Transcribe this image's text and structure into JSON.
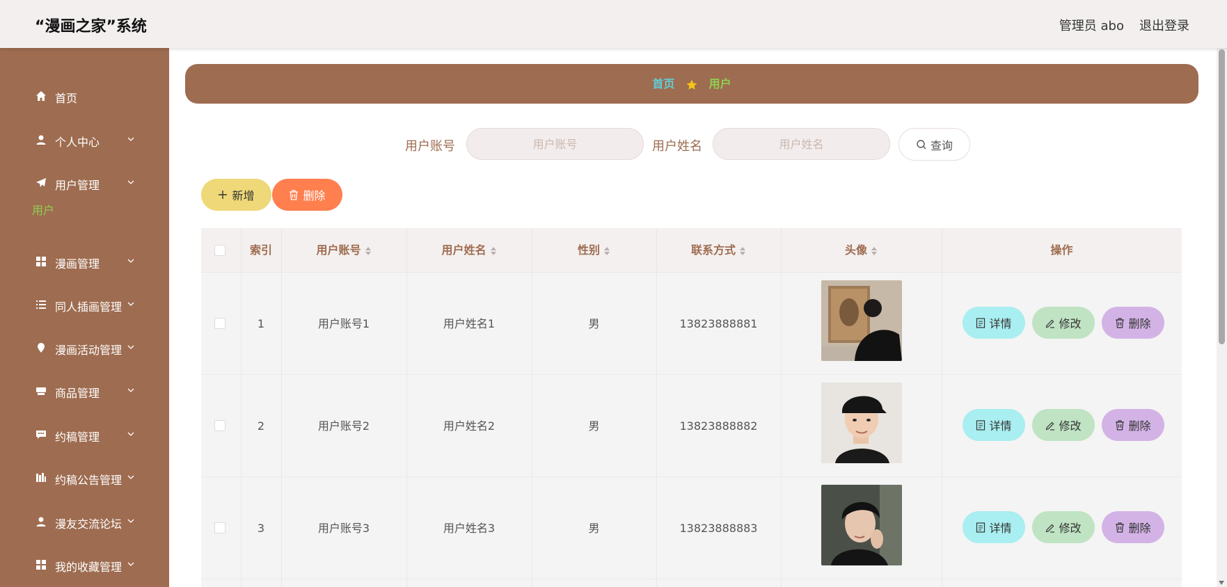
{
  "header": {
    "title": "“漫画之家”系统",
    "admin": "管理员 abo",
    "logout": "退出登录"
  },
  "sidebar": {
    "items": [
      {
        "label": "首页",
        "icon": "home-icon",
        "chevron": false
      },
      {
        "label": "个人中心",
        "icon": "user-icon",
        "chevron": true
      },
      {
        "label": "用户管理",
        "icon": "send-icon",
        "chevron": true
      },
      {
        "label": "漫画管理",
        "icon": "grid-icon",
        "chevron": true
      },
      {
        "label": "同人插画管理",
        "icon": "list-icon",
        "chevron": true
      },
      {
        "label": "漫画活动管理",
        "icon": "location-icon",
        "chevron": true
      },
      {
        "label": "商品管理",
        "icon": "shop-icon",
        "chevron": true
      },
      {
        "label": "约稿管理",
        "icon": "chat-icon",
        "chevron": true
      },
      {
        "label": "约稿公告管理",
        "icon": "chart-icon",
        "chevron": true
      },
      {
        "label": "漫友交流论坛",
        "icon": "person-icon",
        "chevron": true
      },
      {
        "label": "我的收藏管理",
        "icon": "grid-icon",
        "chevron": true
      }
    ],
    "active_sub": "用户"
  },
  "breadcrumb": {
    "home": "首页",
    "current": "用户"
  },
  "search": {
    "account_label": "用户账号",
    "account_placeholder": "用户账号",
    "name_label": "用户姓名",
    "name_placeholder": "用户姓名",
    "query_label": "查询"
  },
  "actions": {
    "add": "新增",
    "delete": "删除"
  },
  "table": {
    "columns": [
      "索引",
      "用户账号",
      "用户姓名",
      "性别",
      "联系方式",
      "头像",
      "操作"
    ],
    "rows": [
      {
        "index": "1",
        "account": "用户账号1",
        "name": "用户姓名1",
        "gender": "男",
        "phone": "13823888881"
      },
      {
        "index": "2",
        "account": "用户账号2",
        "name": "用户姓名2",
        "gender": "男",
        "phone": "13823888882"
      },
      {
        "index": "3",
        "account": "用户账号3",
        "name": "用户姓名3",
        "gender": "男",
        "phone": "13823888883"
      }
    ],
    "ops": {
      "detail": "详情",
      "edit": "修改",
      "delete": "删除"
    }
  },
  "colors": {
    "brand": "#9e6c50",
    "active": "#8fd14f",
    "crumb_home": "#5fd0d9",
    "add": "#efd878",
    "delete": "#ff7f4f"
  }
}
